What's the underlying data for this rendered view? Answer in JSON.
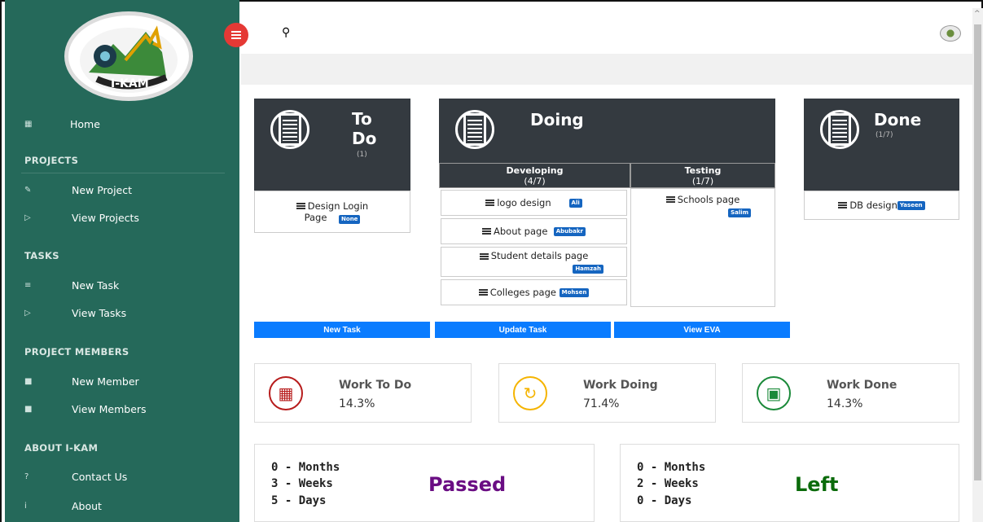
{
  "sidebar": {
    "home": "Home",
    "sections": {
      "projects": "PROJECTS",
      "tasks": "TASKS",
      "members": "PROJECT MEMBERS",
      "about": "ABOUT I-KAM"
    },
    "items": {
      "new_project": "New Project",
      "view_projects": "View Projects",
      "new_task": "New Task",
      "view_tasks": "View Tasks",
      "new_member": "New Member",
      "view_members": "View Members",
      "contact": "Contact Us",
      "about": "About"
    },
    "icons": {
      "home": "home-icon",
      "new_project": "edit-icon",
      "view_projects": "tag-icon",
      "new_task": "list-icon",
      "view_tasks": "tag-icon",
      "new_member": "user-icon",
      "view_members": "user-icon",
      "contact": "question-icon",
      "about": "info-icon"
    }
  },
  "kanban": {
    "todo": {
      "title_line1": "To",
      "title_line2": "Do",
      "count": "(1)"
    },
    "doing": {
      "title": "Doing"
    },
    "developing": {
      "title": "Developing",
      "count": "(4/7)"
    },
    "testing": {
      "title": "Testing",
      "count": "(1/7)"
    },
    "done": {
      "title": "Done",
      "count": "(1/7)"
    },
    "cards": {
      "design_login_1": "Design Login",
      "design_login_2": "Page",
      "design_login_badge": "None",
      "logo_design": "logo design",
      "logo_badge": "Ali",
      "about_page": "About page",
      "about_badge": "Abubakr",
      "student_details": "Student details page",
      "student_badge": "Hamzah",
      "colleges_page": "Colleges page",
      "colleges_badge": "Mohsen",
      "schools_page": "Schools page",
      "schools_badge": "Salim",
      "db_design": "DB design",
      "db_badge": "Yaseen"
    }
  },
  "actions": {
    "new_task": "New Task",
    "update_task": "Update Task",
    "view_eva": "View EVA"
  },
  "stats": {
    "todo": {
      "label": "Work To Do",
      "value": "14.3%"
    },
    "doing": {
      "label": "Work Doing",
      "value": "71.4%"
    },
    "done": {
      "label": "Work Done",
      "value": "14.3%"
    }
  },
  "time": {
    "passed": {
      "months": "0 - Months",
      "weeks": "3 - Weeks",
      "days": "5 - Days",
      "label": "Passed"
    },
    "left": {
      "months": "0 - Months",
      "weeks": "2 - Weeks",
      "days": "0 - Days",
      "label": "Left"
    }
  },
  "colors": {
    "sidebar": "#25695a",
    "accent_blue": "#0a7cff",
    "todo_red": "#b71c1c",
    "doing_yellow": "#f5b400",
    "done_green": "#1b8a3a",
    "passed_purple": "#6a0d83",
    "left_green": "#0b6b0b"
  }
}
